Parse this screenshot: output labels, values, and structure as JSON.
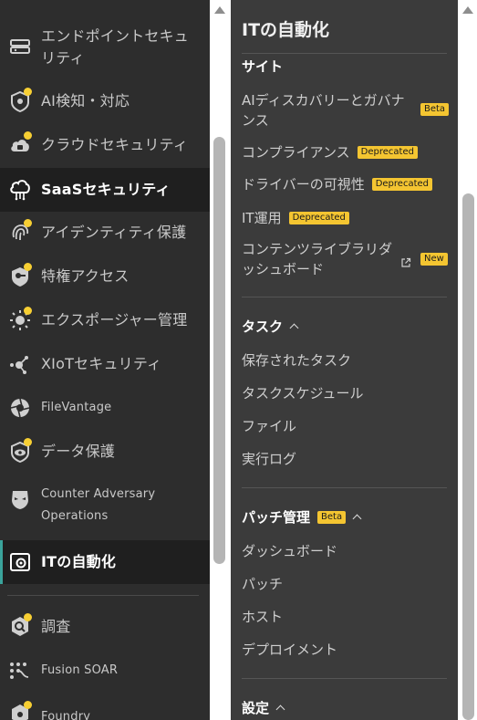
{
  "left_nav": {
    "items": [
      {
        "label": "エンドポイントセキュリティ",
        "icon": "endpoint-icon",
        "dot": false
      },
      {
        "label": "AI検知・対応",
        "icon": "ai-detection-icon",
        "dot": true
      },
      {
        "label": "クラウドセキュリティ",
        "icon": "cloud-lock-icon",
        "dot": true
      },
      {
        "label": "SaaSセキュリティ",
        "icon": "saas-cloud-icon",
        "dot": false,
        "state": "selected"
      },
      {
        "label": "アイデンティティ保護",
        "icon": "fingerprint-icon",
        "dot": true
      },
      {
        "label": "特権アクセス",
        "icon": "key-shield-icon",
        "dot": true
      },
      {
        "label": "エクスポージャー管理",
        "icon": "exposure-sun-icon",
        "dot": true
      },
      {
        "label": "XIoTセキュリティ",
        "icon": "xiot-node-icon",
        "dot": false
      },
      {
        "label": "FileVantage",
        "icon": "filevantage-shutter-icon",
        "dot": false
      },
      {
        "label": "データ保護",
        "icon": "data-eye-icon",
        "dot": true
      },
      {
        "label": "Counter Adversary Operations",
        "icon": "adversary-mask-icon",
        "dot": false
      },
      {
        "label": "ITの自動化",
        "icon": "it-automation-icon",
        "dot": false,
        "state": "current"
      },
      {
        "label": "調査",
        "icon": "investigate-icon",
        "dot": true
      },
      {
        "label": "Fusion SOAR",
        "icon": "soar-flow-icon",
        "dot": false
      },
      {
        "label": "Foundry",
        "icon": "foundry-icon",
        "dot": true
      }
    ]
  },
  "panel": {
    "title": "ITの自動化",
    "site": {
      "title": "サイト",
      "items": [
        {
          "label": "AIディスカバリーとガバナンス",
          "tag": "Beta"
        },
        {
          "label": "コンプライアンス",
          "tag": "Deprecated"
        },
        {
          "label": "ドライバーの可視性",
          "tag": "Deprecated"
        },
        {
          "label": "IT運用",
          "tag": "Deprecated"
        },
        {
          "label": "コンテンツライブラリダッシュボード",
          "tag": "New",
          "icon": "external-link-icon"
        }
      ]
    },
    "tasks": {
      "title": "タスク",
      "items": [
        "保存されたタスク",
        "タスクスケジュール",
        "ファイル",
        "実行ログ"
      ]
    },
    "patch": {
      "title": "パッチ管理",
      "tag": "Beta",
      "items": [
        "ダッシュボード",
        "パッチ",
        "ホスト",
        "デプロイメント"
      ]
    },
    "settings": {
      "title": "設定"
    }
  },
  "colors": {
    "accent_yellow": "#f7cf33",
    "current_indicator": "#3aa39b",
    "panel_bg": "#3b3b3b",
    "nav_bg": "#2d2d2d"
  }
}
